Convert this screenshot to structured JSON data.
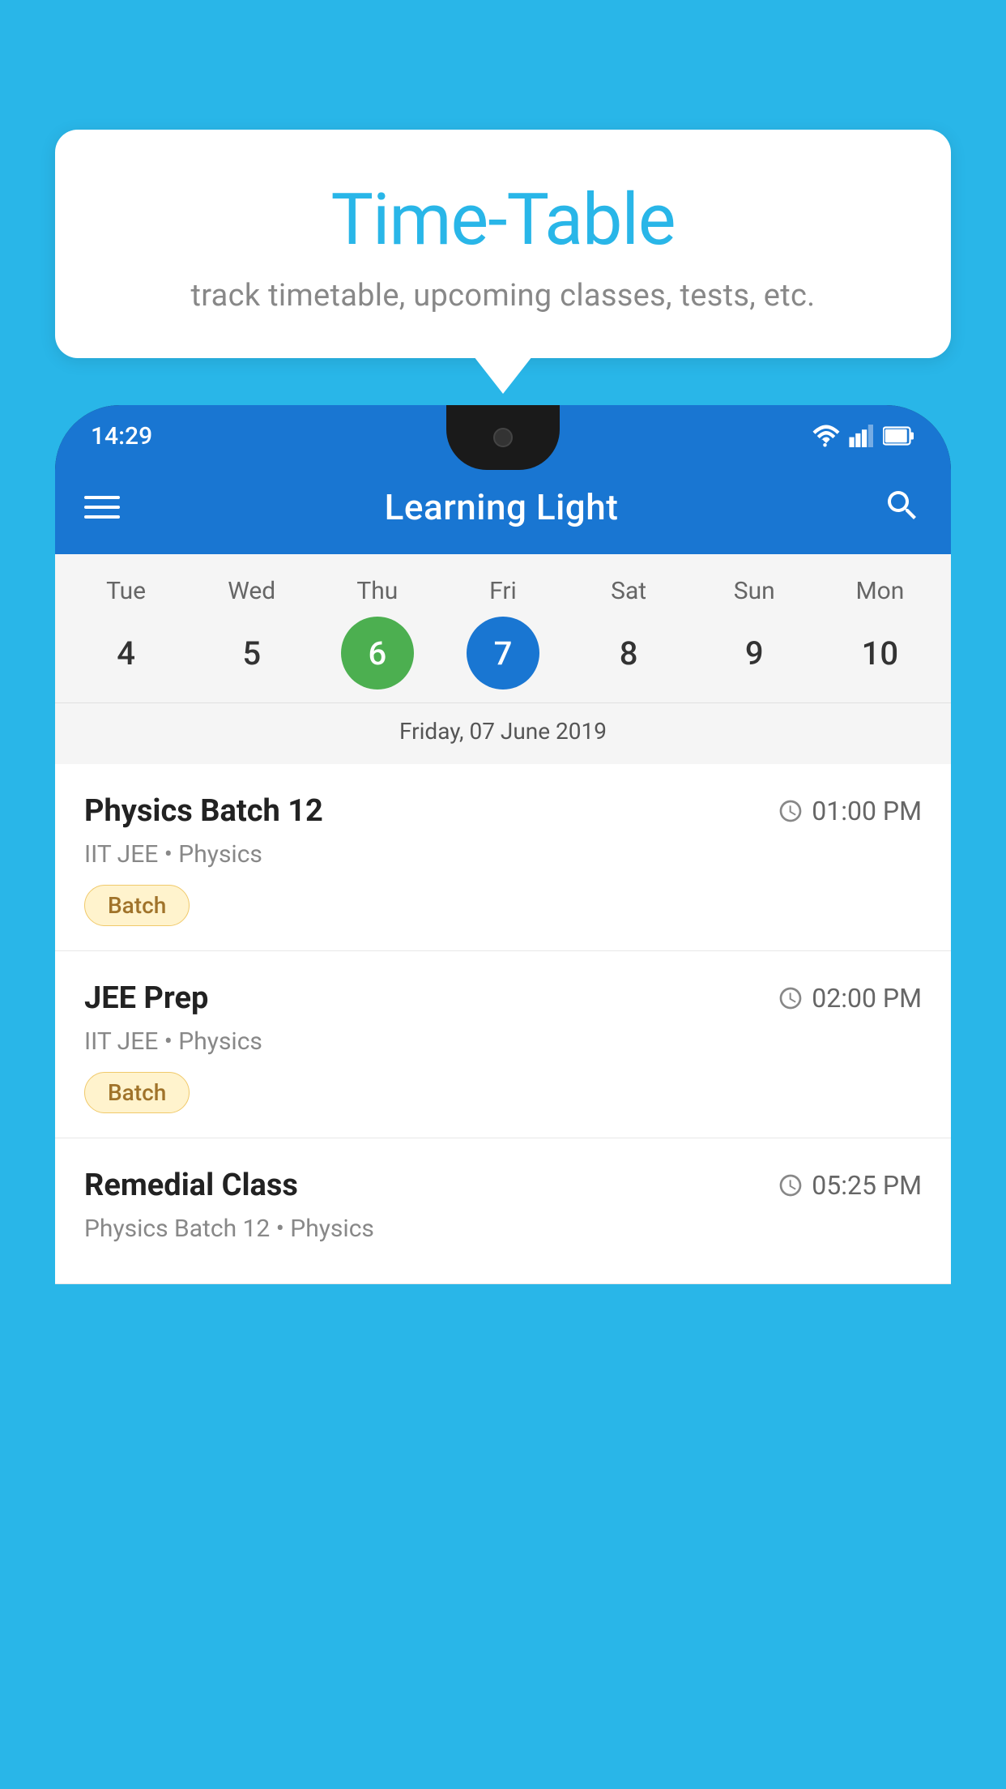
{
  "background": {
    "color": "#29B6E8"
  },
  "speech_bubble": {
    "title": "Time-Table",
    "subtitle": "track timetable, upcoming classes, tests, etc."
  },
  "phone": {
    "status_bar": {
      "time": "14:29"
    },
    "app_bar": {
      "title": "Learning Light"
    },
    "calendar": {
      "days": [
        {
          "name": "Tue",
          "num": "4",
          "state": "normal"
        },
        {
          "name": "Wed",
          "num": "5",
          "state": "normal"
        },
        {
          "name": "Thu",
          "num": "6",
          "state": "today"
        },
        {
          "name": "Fri",
          "num": "7",
          "state": "selected"
        },
        {
          "name": "Sat",
          "num": "8",
          "state": "normal"
        },
        {
          "name": "Sun",
          "num": "9",
          "state": "normal"
        },
        {
          "name": "Mon",
          "num": "10",
          "state": "normal"
        }
      ],
      "selected_date_label": "Friday, 07 June 2019"
    },
    "schedule": [
      {
        "title": "Physics Batch 12",
        "time": "01:00 PM",
        "subtitle": "IIT JEE • Physics",
        "tag": "Batch"
      },
      {
        "title": "JEE Prep",
        "time": "02:00 PM",
        "subtitle": "IIT JEE • Physics",
        "tag": "Batch"
      },
      {
        "title": "Remedial Class",
        "time": "05:25 PM",
        "subtitle": "Physics Batch 12 • Physics",
        "tag": null
      }
    ]
  }
}
